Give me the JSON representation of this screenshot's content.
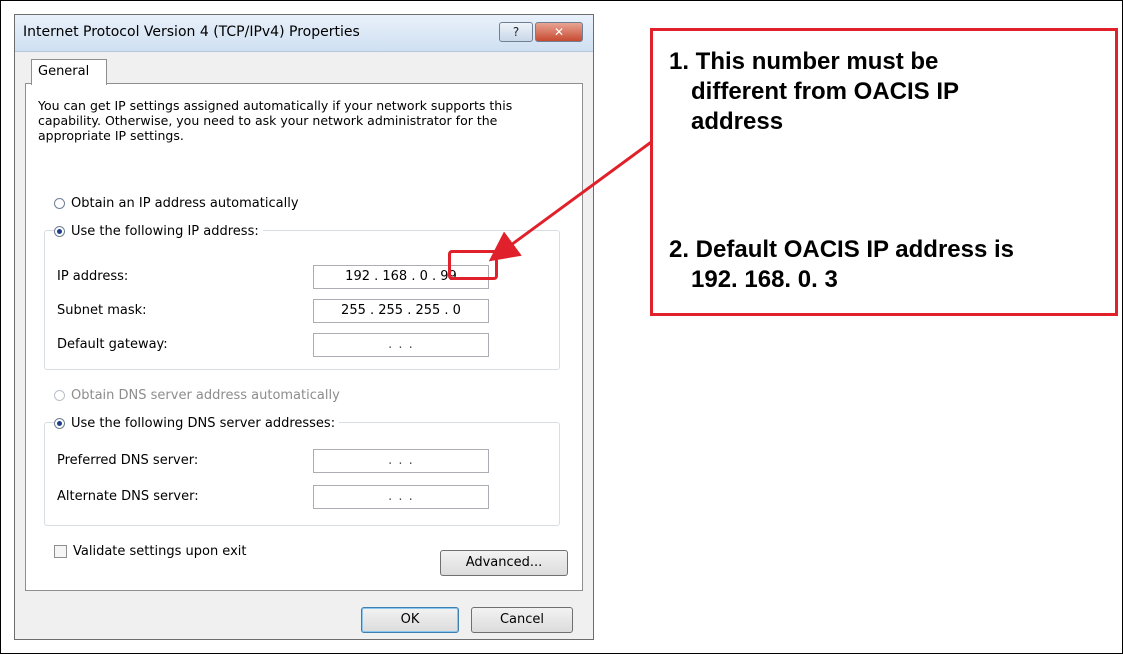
{
  "dialog": {
    "title": "Internet Protocol Version 4 (TCP/IPv4) Properties",
    "help_button": "?",
    "close_button": "✕",
    "tab_general": "General",
    "intro_text": "You can get IP settings assigned automatically if your network supports this capability. Otherwise, you need to ask your network administrator for the appropriate IP settings.",
    "obtain_ip_auto": "Obtain an IP address automatically",
    "use_following_ip": "Use the following IP address:",
    "ip_address_label": "IP address:",
    "ip_address_value": "192 . 168 .  0   . 99",
    "subnet_mask_label": "Subnet mask:",
    "subnet_mask_value": "255 . 255 . 255 .  0",
    "default_gateway_label": "Default gateway:",
    "default_gateway_value": ".        .        .",
    "obtain_dns_auto": "Obtain DNS server address automatically",
    "use_following_dns": "Use the following DNS server addresses:",
    "preferred_dns_label": "Preferred DNS server:",
    "preferred_dns_value": ".        .        .",
    "alternate_dns_label": "Alternate DNS server:",
    "alternate_dns_value": ".        .        .",
    "validate_label": "Validate settings upon exit",
    "advanced_button": "Advanced...",
    "ok_button": "OK",
    "cancel_button": "Cancel"
  },
  "callout": {
    "note1_line1": "1. This number must be",
    "note1_line2": "different from OACIS IP",
    "note1_line3": "address",
    "note2_line1": "2. Default OACIS IP address is",
    "note2_line2": "192. 168. 0. 3"
  },
  "colors": {
    "annotation_red": "#e0202a"
  }
}
